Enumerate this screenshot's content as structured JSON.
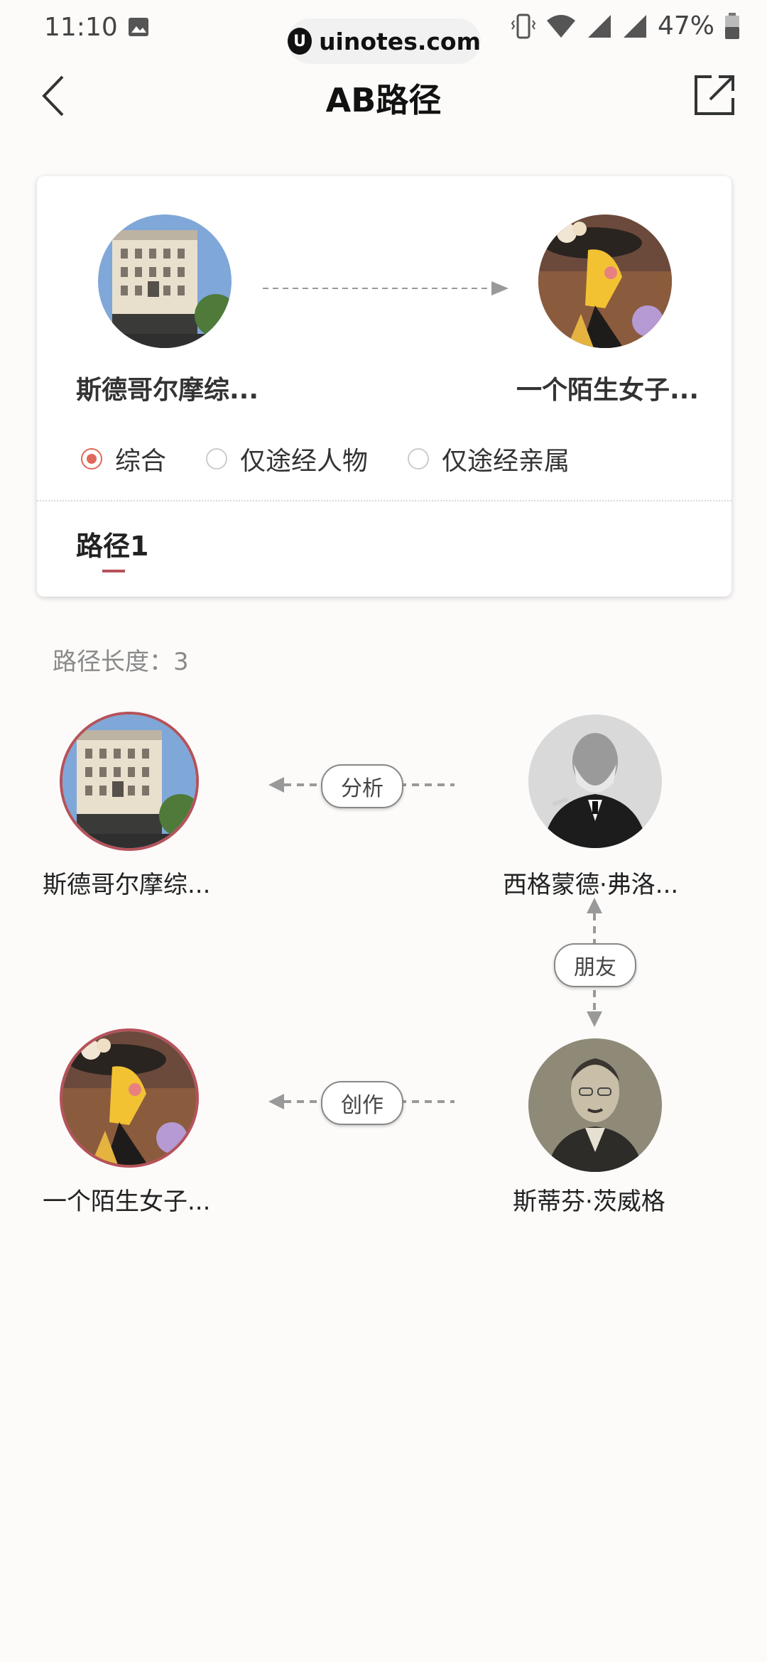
{
  "status_bar": {
    "time": "11:10",
    "battery": "47%"
  },
  "watermark": {
    "text": "uinotes.com"
  },
  "header": {
    "title": "AB路径"
  },
  "card": {
    "from_name": "斯德哥尔摩综...",
    "to_name": "一个陌生女子...",
    "filters": [
      {
        "label": "综合",
        "selected": true
      },
      {
        "label": "仅途经人物",
        "selected": false
      },
      {
        "label": "仅途经亲属",
        "selected": false
      }
    ],
    "tab": "路径1"
  },
  "path": {
    "length_label": "路径长度：3",
    "nodes": [
      {
        "name": "斯德哥尔摩综...",
        "image": "building-photo"
      },
      {
        "name": "西格蒙德·弗洛...",
        "image": "freud-portrait"
      },
      {
        "name": "斯蒂芬·茨威格",
        "image": "zweig-portrait"
      },
      {
        "name": "一个陌生女子...",
        "image": "painted-woman"
      }
    ],
    "relations": [
      "分析",
      "朋友",
      "创作"
    ]
  },
  "colors": {
    "accent": "#b5525a",
    "radio": "#e0685a"
  }
}
